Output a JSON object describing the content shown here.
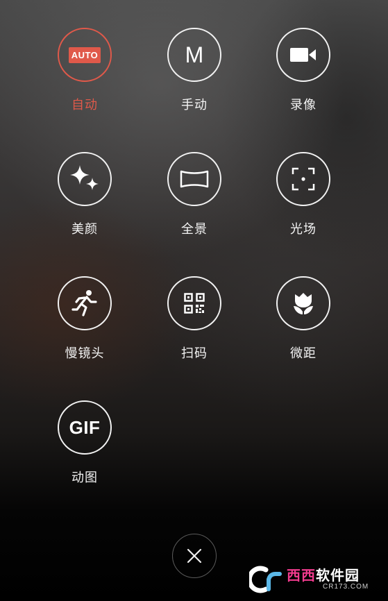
{
  "modes": [
    {
      "id": "auto",
      "label": "自动",
      "glyph": "AUTO",
      "icon": "auto-badge-icon",
      "active": true
    },
    {
      "id": "manual",
      "label": "手动",
      "glyph": "M",
      "icon": "manual-m-icon",
      "active": false
    },
    {
      "id": "video",
      "label": "录像",
      "icon": "video-camera-icon",
      "active": false
    },
    {
      "id": "beauty",
      "label": "美颜",
      "icon": "sparkle-icon",
      "active": false
    },
    {
      "id": "panorama",
      "label": "全景",
      "icon": "panorama-icon",
      "active": false
    },
    {
      "id": "lightfield",
      "label": "光场",
      "icon": "focus-frame-icon",
      "active": false
    },
    {
      "id": "slowmo",
      "label": "慢镜头",
      "icon": "running-person-icon",
      "active": false
    },
    {
      "id": "scan",
      "label": "扫码",
      "icon": "qr-code-icon",
      "active": false
    },
    {
      "id": "macro",
      "label": "微距",
      "icon": "tulip-macro-icon",
      "active": false
    },
    {
      "id": "gif",
      "label": "动图",
      "glyph": "GIF",
      "icon": "gif-icon",
      "active": false
    }
  ],
  "close": {
    "icon": "close-icon"
  },
  "watermark": {
    "brand_a": "西西",
    "brand_b": "软件园",
    "url": "CR173.COM"
  },
  "colors": {
    "active": "#e0594a",
    "icon": "#ffffff",
    "watermark_pink": "#f23b8e"
  }
}
